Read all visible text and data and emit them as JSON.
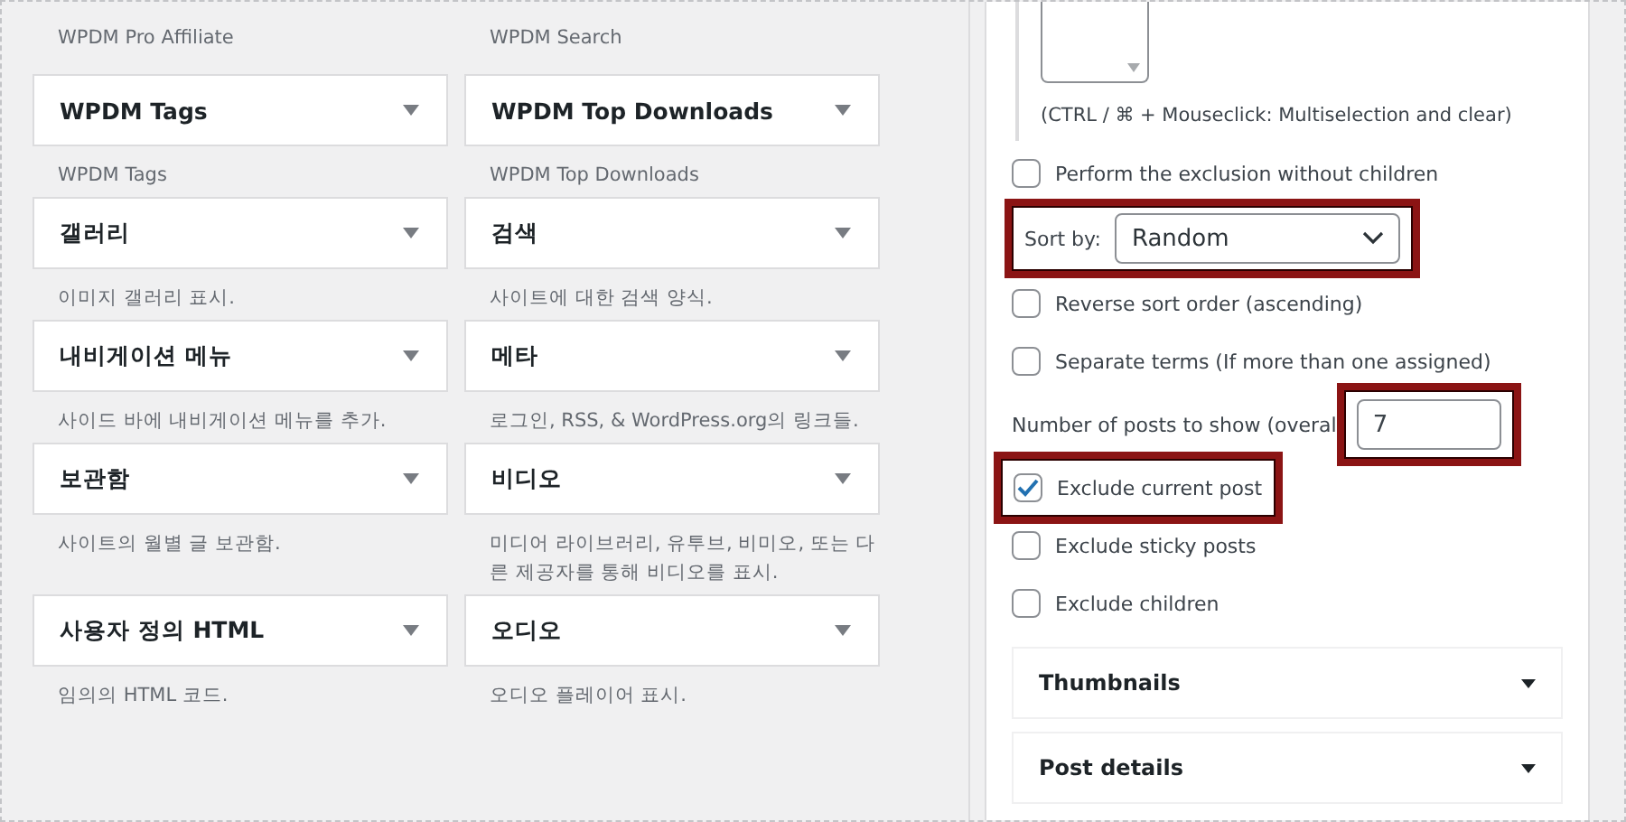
{
  "widgets_area": {
    "top_descriptions": [
      "WPDM Pro Affiliate",
      "WPDM Search"
    ],
    "widgets": [
      {
        "title": "WPDM Tags",
        "description": "WPDM Tags"
      },
      {
        "title": "WPDM Top Downloads",
        "description": "WPDM Top Downloads"
      },
      {
        "title": "갤러리",
        "description": "이미지 갤러리 표시."
      },
      {
        "title": "검색",
        "description": "사이트에 대한 검색 양식."
      },
      {
        "title": "내비게이션 메뉴",
        "description": "사이드 바에 내비게이션 메뉴를 추가."
      },
      {
        "title": "메타",
        "description": "로그인, RSS, & WordPress.org의 링크들."
      },
      {
        "title": "보관함",
        "description": "사이트의 월별 글 보관함."
      },
      {
        "title": "비디오",
        "description": "미디어 라이브러리, 유투브, 비미오, 또는 다른 제공자를 통해 비디오를 표시."
      },
      {
        "title": "사용자 정의 HTML",
        "description": "임의의 HTML 코드."
      },
      {
        "title": "오디오",
        "description": "오디오 플레이어 표시."
      }
    ]
  },
  "settings_panel": {
    "hint": "(CTRL / ⌘ + Mouseclick: Multiselection and clear)",
    "options": [
      {
        "kind": "checkbox",
        "label": "Perform the exclusion without children",
        "checked": false,
        "highlighted": false
      },
      {
        "kind": "select",
        "label": "Sort by:",
        "value": "Random",
        "highlighted": true
      },
      {
        "kind": "checkbox",
        "label": "Reverse sort order (ascending)",
        "checked": false,
        "highlighted": false
      },
      {
        "kind": "checkbox",
        "label": "Separate terms (If more than one assigned)",
        "checked": false,
        "highlighted": false
      },
      {
        "kind": "number",
        "label": "Number of posts to show (overal",
        "value": "7",
        "highlighted": true
      },
      {
        "kind": "checkbox",
        "label": "Exclude current post",
        "checked": true,
        "highlighted": true
      },
      {
        "kind": "checkbox",
        "label": "Exclude sticky posts",
        "checked": false,
        "highlighted": false
      },
      {
        "kind": "checkbox",
        "label": "Exclude children",
        "checked": false,
        "highlighted": false
      }
    ],
    "sections": [
      {
        "title": "Thumbnails",
        "expanded": false
      },
      {
        "title": "Post details",
        "expanded": false
      }
    ]
  }
}
